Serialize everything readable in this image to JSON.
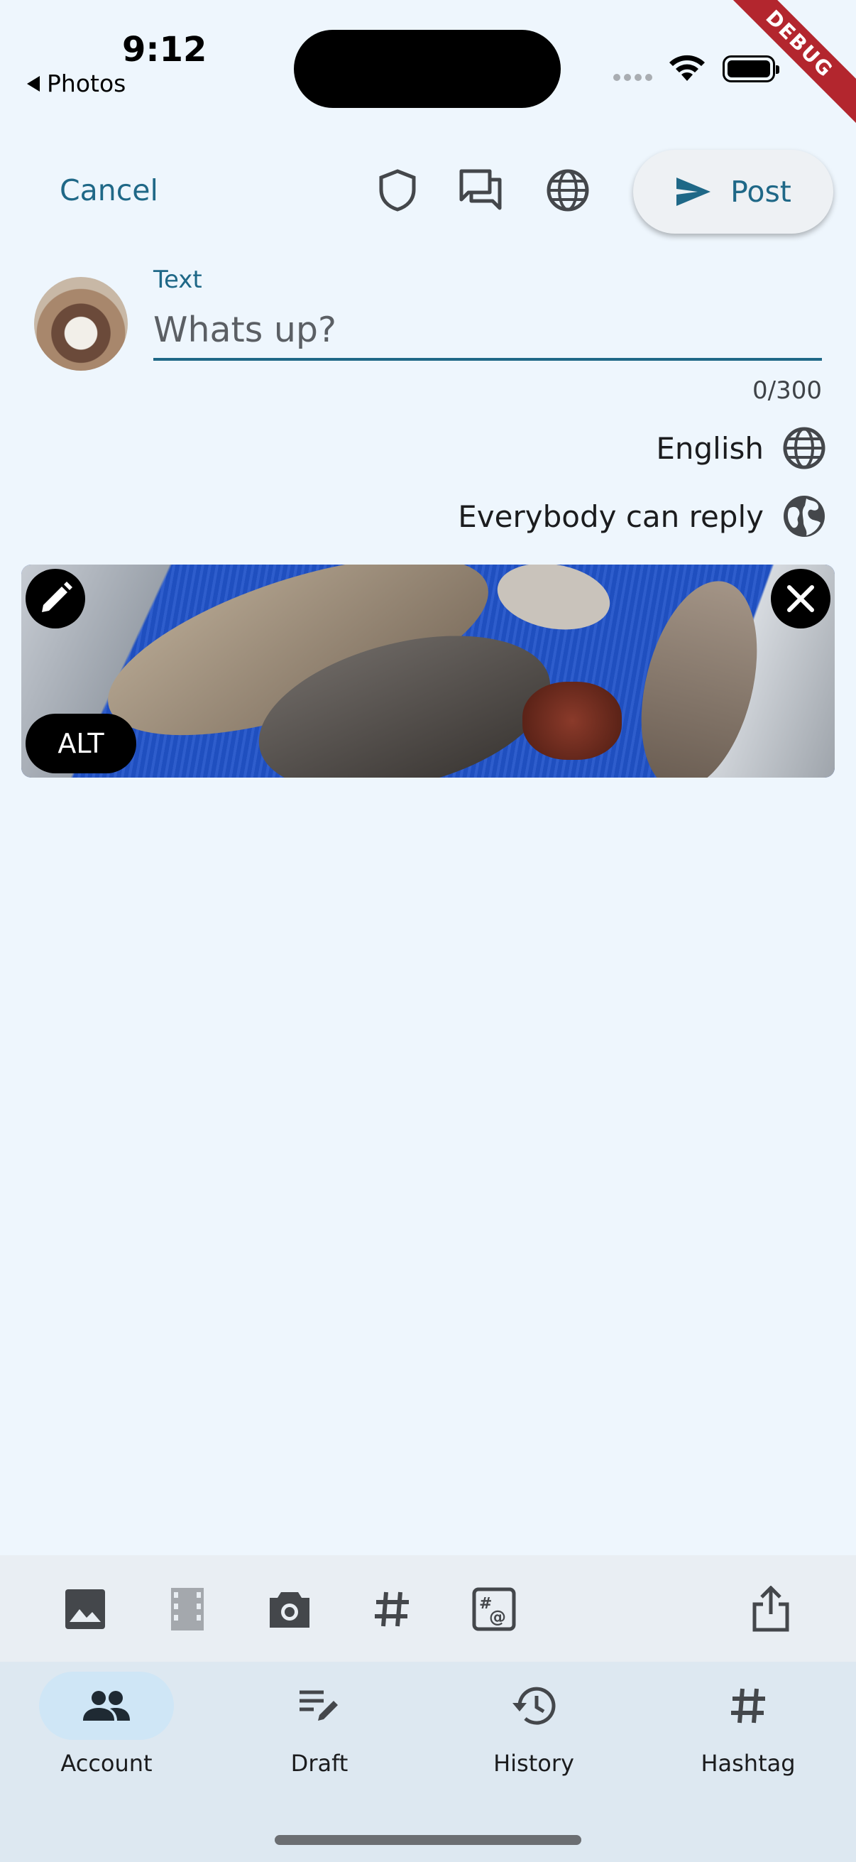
{
  "status_bar": {
    "time": "9:12",
    "back_app": "Photos",
    "debug_banner": "DEBUG"
  },
  "toolbar": {
    "cancel_label": "Cancel",
    "icons": [
      "shield-icon",
      "forum-icon",
      "globe-icon"
    ],
    "post_label": "Post"
  },
  "compose": {
    "text_label": "Text",
    "text_placeholder": "Whats up?",
    "text_value": "",
    "counter": "0/300",
    "language": "English",
    "reply_setting": "Everybody can reply"
  },
  "media": {
    "alt_label": "ALT",
    "description": "photo of fish on blue conveyor belt"
  },
  "action_bar": {
    "icons": [
      "image-icon",
      "video-icon",
      "camera-icon",
      "hashtag-icon",
      "mention-tag-icon",
      "share-icon"
    ]
  },
  "nav": {
    "items": [
      {
        "label": "Account",
        "icon": "people-icon",
        "selected": true
      },
      {
        "label": "Draft",
        "icon": "draft-edit-icon",
        "selected": false
      },
      {
        "label": "History",
        "icon": "history-icon",
        "selected": false
      },
      {
        "label": "Hashtag",
        "icon": "hashtag-icon",
        "selected": false
      }
    ]
  },
  "colors": {
    "accent": "#1f6887",
    "background": "#eef6fd",
    "nav_background": "#dde8f1",
    "nav_pill": "#cfe6f6",
    "debug": "#b3262e"
  }
}
